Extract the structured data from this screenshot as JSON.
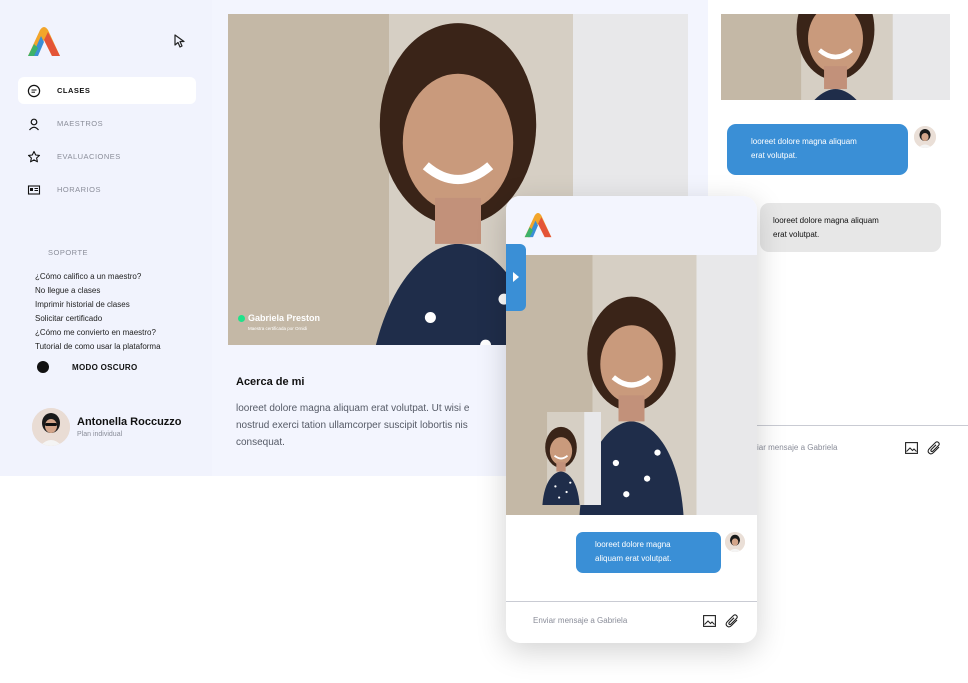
{
  "sidebar": {
    "nav": [
      {
        "label": "CLASES",
        "icon": "chat-icon",
        "active": true
      },
      {
        "label": "MAESTROS",
        "icon": "user-icon",
        "active": false
      },
      {
        "label": "EVALUACIONES",
        "icon": "star-icon",
        "active": false
      },
      {
        "label": "HORARIOS",
        "icon": "id-card-icon",
        "active": false
      }
    ],
    "support_title": "SOPORTE",
    "faq": [
      "¿Cómo califico a un maestro?",
      "No llegue a clases",
      "Imprimir historial de clases",
      "Solicitar certificado",
      "¿Cómo me convierto en maestro?",
      "Tutorial de como usar la plataforma"
    ],
    "dark_mode_label": "MODO OSCURO",
    "user": {
      "name": "Antonella Roccuzzo",
      "plan": "Plan individual"
    }
  },
  "video": {
    "teacher_name": "Gabriela Preston",
    "teacher_subtitle": "Maestra certificada por Ornidi"
  },
  "about": {
    "title": "Acerca de mi",
    "text_lines": [
      "looreet dolore magna aliquam erat volutpat. Ut wisi e",
      "nostrud exerci tation ullamcorper suscipit lobortis nis",
      "consequat."
    ]
  },
  "chat": {
    "message_sent": [
      "looreet dolore magna aliquam",
      "erat volutpat."
    ],
    "message_received": [
      "looreet dolore magna aliquam",
      "erat volutpat."
    ],
    "input_placeholder": "Enviar mensaje a Gabriela",
    "input_placeholder_clipped": "iar mensaje a Gabriela"
  },
  "mobile": {
    "message": [
      "looreet dolore magna",
      "aliquam erat volutpat."
    ],
    "input_placeholder": "Enviar mensaje a Gabriela"
  },
  "colors": {
    "accent": "#3a8fd6",
    "sidebar_bg": "#f1f3fd",
    "live": "#20e28a"
  }
}
